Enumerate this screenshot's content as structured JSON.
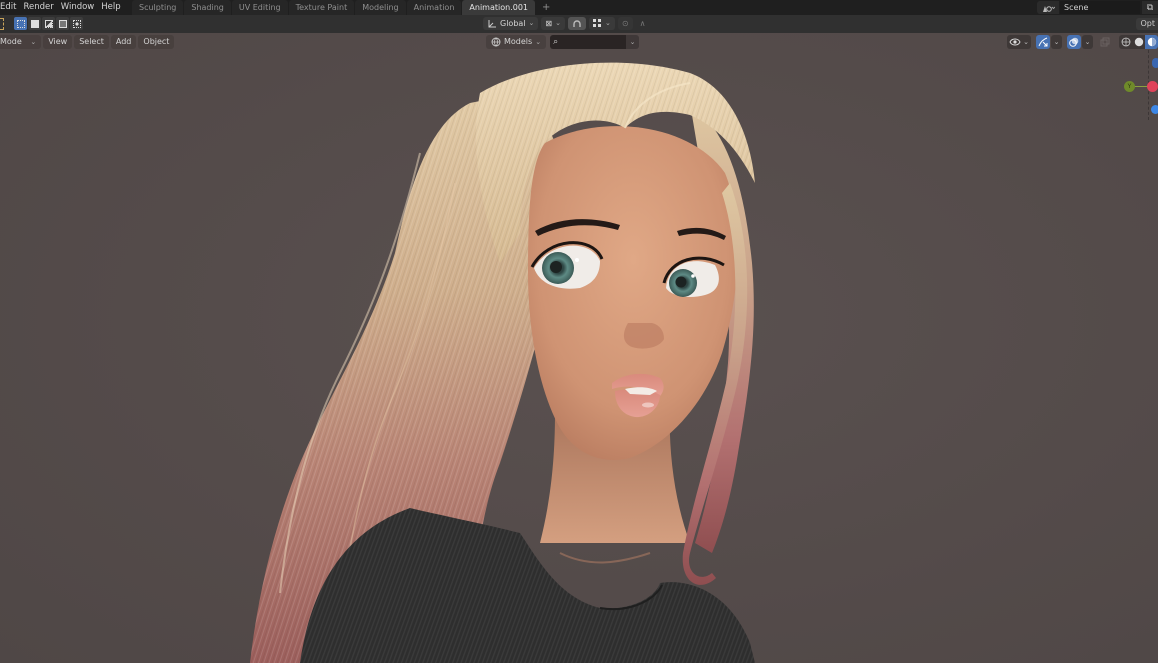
{
  "topbar": {
    "menu": [
      "Edit",
      "Render",
      "Window",
      "Help"
    ],
    "workspace_tabs": [
      {
        "label": "Sculpting",
        "active": false
      },
      {
        "label": "Shading",
        "active": false
      },
      {
        "label": "UV Editing",
        "active": false
      },
      {
        "label": "Texture Paint",
        "active": false
      },
      {
        "label": "Modeling",
        "active": false
      },
      {
        "label": "Animation",
        "active": false
      },
      {
        "label": "Animation.001",
        "active": true
      }
    ],
    "add_tab": "+",
    "scene_icon": "scene-icon",
    "scene_name": "Scene",
    "new_scene_icon": "⧉"
  },
  "toolbar": {
    "selection_modes": [
      "select-new",
      "select-extend",
      "select-subtract",
      "select-invert",
      "select-intersect"
    ],
    "transform_orientation": "Global",
    "pivot_icon": "⊠",
    "snap_icon": "⧉",
    "proportional_icon": "⊙",
    "falloff_icon": "∧",
    "options_label": "Opt"
  },
  "viewport_header": {
    "mode": "Mode",
    "menus": [
      "View",
      "Select",
      "Add",
      "Object"
    ],
    "filter_label": "Models",
    "search_value": "",
    "search_icon": "⌕",
    "visibility_icon": "eye-icon",
    "gizmo_icon": "gizmo-icon",
    "overlay_icon": "overlay-icon",
    "xray_icon": "xray-icon",
    "shading_modes": [
      "wireframe",
      "solid",
      "material-preview"
    ],
    "active_shading": "material-preview"
  },
  "navigation_gizmo": {
    "y_label": "Y",
    "colors": {
      "x": "#e0435a",
      "y": "#6f8a2a",
      "z": "#3d87e6"
    }
  },
  "colors": {
    "accent": "#4772b3",
    "background": "#554c4b",
    "topbar": "#1f1f1f",
    "header": "#303030"
  }
}
